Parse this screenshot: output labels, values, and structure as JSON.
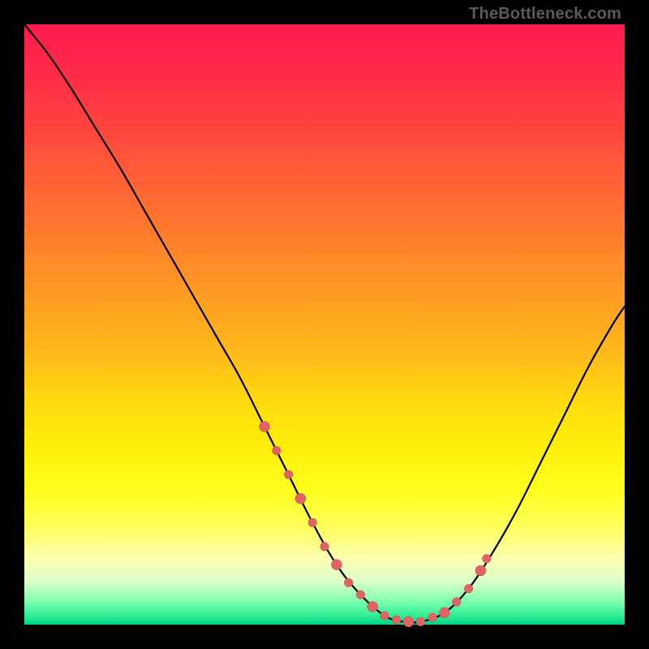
{
  "watermark": "TheBottleneck.com",
  "colors": {
    "frame": "#000000",
    "curve": "#000000",
    "dots": "#e06464",
    "gradient_top": "#ff1a4d",
    "gradient_bottom": "#00d080"
  },
  "chart_data": {
    "type": "line",
    "title": "",
    "xlabel": "",
    "ylabel": "",
    "xlim": [
      0,
      100
    ],
    "ylim": [
      0,
      100
    ],
    "series": [
      {
        "name": "bottleneck-curve",
        "x": [
          0,
          4,
          8,
          12,
          16,
          20,
          24,
          28,
          32,
          36,
          40,
          44,
          48,
          52,
          56,
          60,
          63,
          66,
          70,
          74,
          78,
          82,
          86,
          90,
          94,
          98,
          100
        ],
        "y": [
          100,
          95,
          89,
          82.5,
          76,
          69,
          62,
          55,
          48,
          41,
          33,
          25,
          17,
          10,
          5,
          1.5,
          0.5,
          0.5,
          2,
          6,
          12,
          19,
          27,
          35,
          43,
          50,
          53
        ]
      }
    ],
    "highlight_dots": {
      "name": "tolerance-band-dots",
      "x": [
        40,
        42,
        44,
        46,
        48,
        50,
        52,
        54,
        56,
        58,
        60,
        62,
        64,
        66,
        68,
        70,
        72,
        74,
        76,
        77
      ],
      "y": [
        33,
        29,
        25,
        21,
        17,
        13,
        10,
        7,
        5,
        3,
        1.5,
        0.8,
        0.5,
        0.5,
        1.2,
        2,
        3.8,
        6,
        9,
        11
      ]
    }
  }
}
